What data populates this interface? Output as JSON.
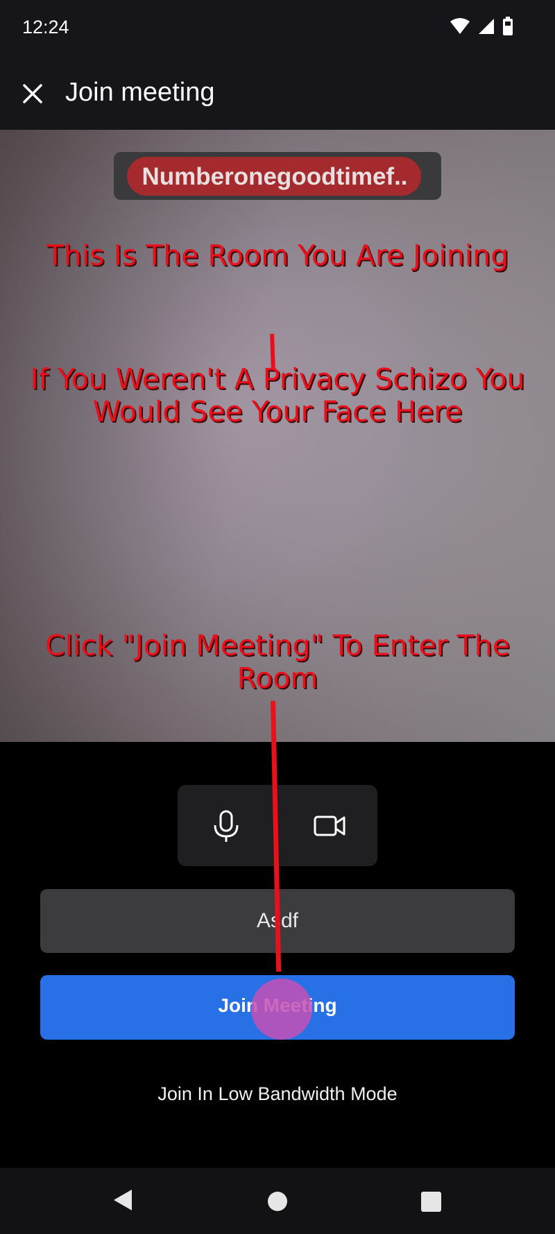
{
  "status_bar": {
    "time": "12:24",
    "icons": [
      "wifi-icon",
      "signal-icon",
      "battery-icon"
    ]
  },
  "app_bar": {
    "title": "Join meeting",
    "close_icon": "close-icon"
  },
  "preview": {
    "room_name": "Numberonegoodtimef..",
    "annotations": [
      "This Is The Room You Are Joining",
      "If You Weren't A Privacy Schizo You Would See Your Face Here",
      "Click \"Join Meeting\" To Enter The Room"
    ]
  },
  "controls": {
    "mic_icon": "microphone-icon",
    "camera_icon": "video-camera-icon"
  },
  "name_field": {
    "value": "Asdf"
  },
  "join_button": {
    "label": "Join Meeting"
  },
  "low_bandwidth": {
    "label": "Join In Low Bandwidth Mode"
  },
  "nav": {
    "back": "back-icon",
    "home": "home-icon",
    "recent": "recent-apps-icon"
  },
  "colors": {
    "accent": "#2870e6",
    "annotation": "#e8101a",
    "tap_indicator": "#c450b4"
  }
}
